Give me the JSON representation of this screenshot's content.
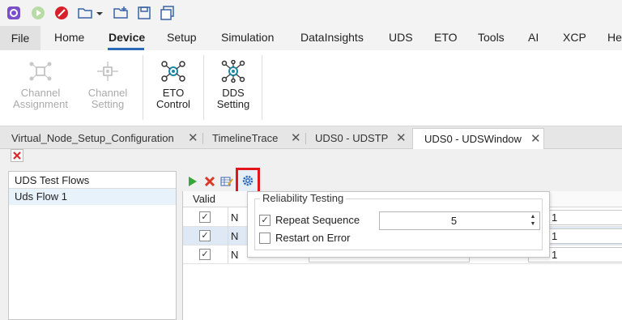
{
  "ribbon": {
    "tabs": [
      "File",
      "Home",
      "Device",
      "Setup",
      "Simulation",
      "DataInsights",
      "UDS",
      "ETO",
      "Tools",
      "AI",
      "XCP",
      "He"
    ],
    "active_tab": "Device",
    "buttons": {
      "channel_assignment": [
        "Channel",
        "Assignment"
      ],
      "channel_setting": [
        "Channel",
        "Setting"
      ],
      "eto_control": [
        "ETO",
        "Control"
      ],
      "dds_setting": [
        "DDS",
        "Setting"
      ]
    }
  },
  "doc_tabs": [
    {
      "label": "Virtual_Node_Setup_Configuration",
      "close": "✕"
    },
    {
      "label": "TimelineTrace",
      "close": "✕"
    },
    {
      "label": "UDS0 - UDSTP",
      "close": "✕"
    },
    {
      "label": "UDS0 - UDSWindow",
      "close": "✕"
    }
  ],
  "flows_panel": {
    "header": "UDS Test Flows",
    "items": [
      "Uds Flow 1"
    ]
  },
  "grid": {
    "header_valid": "Valid",
    "rows": [
      {
        "valid": "✓",
        "name": "N",
        "value": "1"
      },
      {
        "valid": "✓",
        "name": "N",
        "value": "1"
      },
      {
        "valid": "✓",
        "name": "N",
        "value": "1"
      }
    ]
  },
  "popup": {
    "group_title": "Reliability Testing",
    "repeat_label": "Repeat Sequence",
    "repeat_checked": "✓",
    "repeat_value": "5",
    "restart_label": "Restart on Error",
    "spin_up": "▲",
    "spin_down": "▼"
  },
  "colors": {
    "accent": "#2a6ab8",
    "highlight_border": "#e3141a",
    "selected_row": "#dfe9f6"
  }
}
